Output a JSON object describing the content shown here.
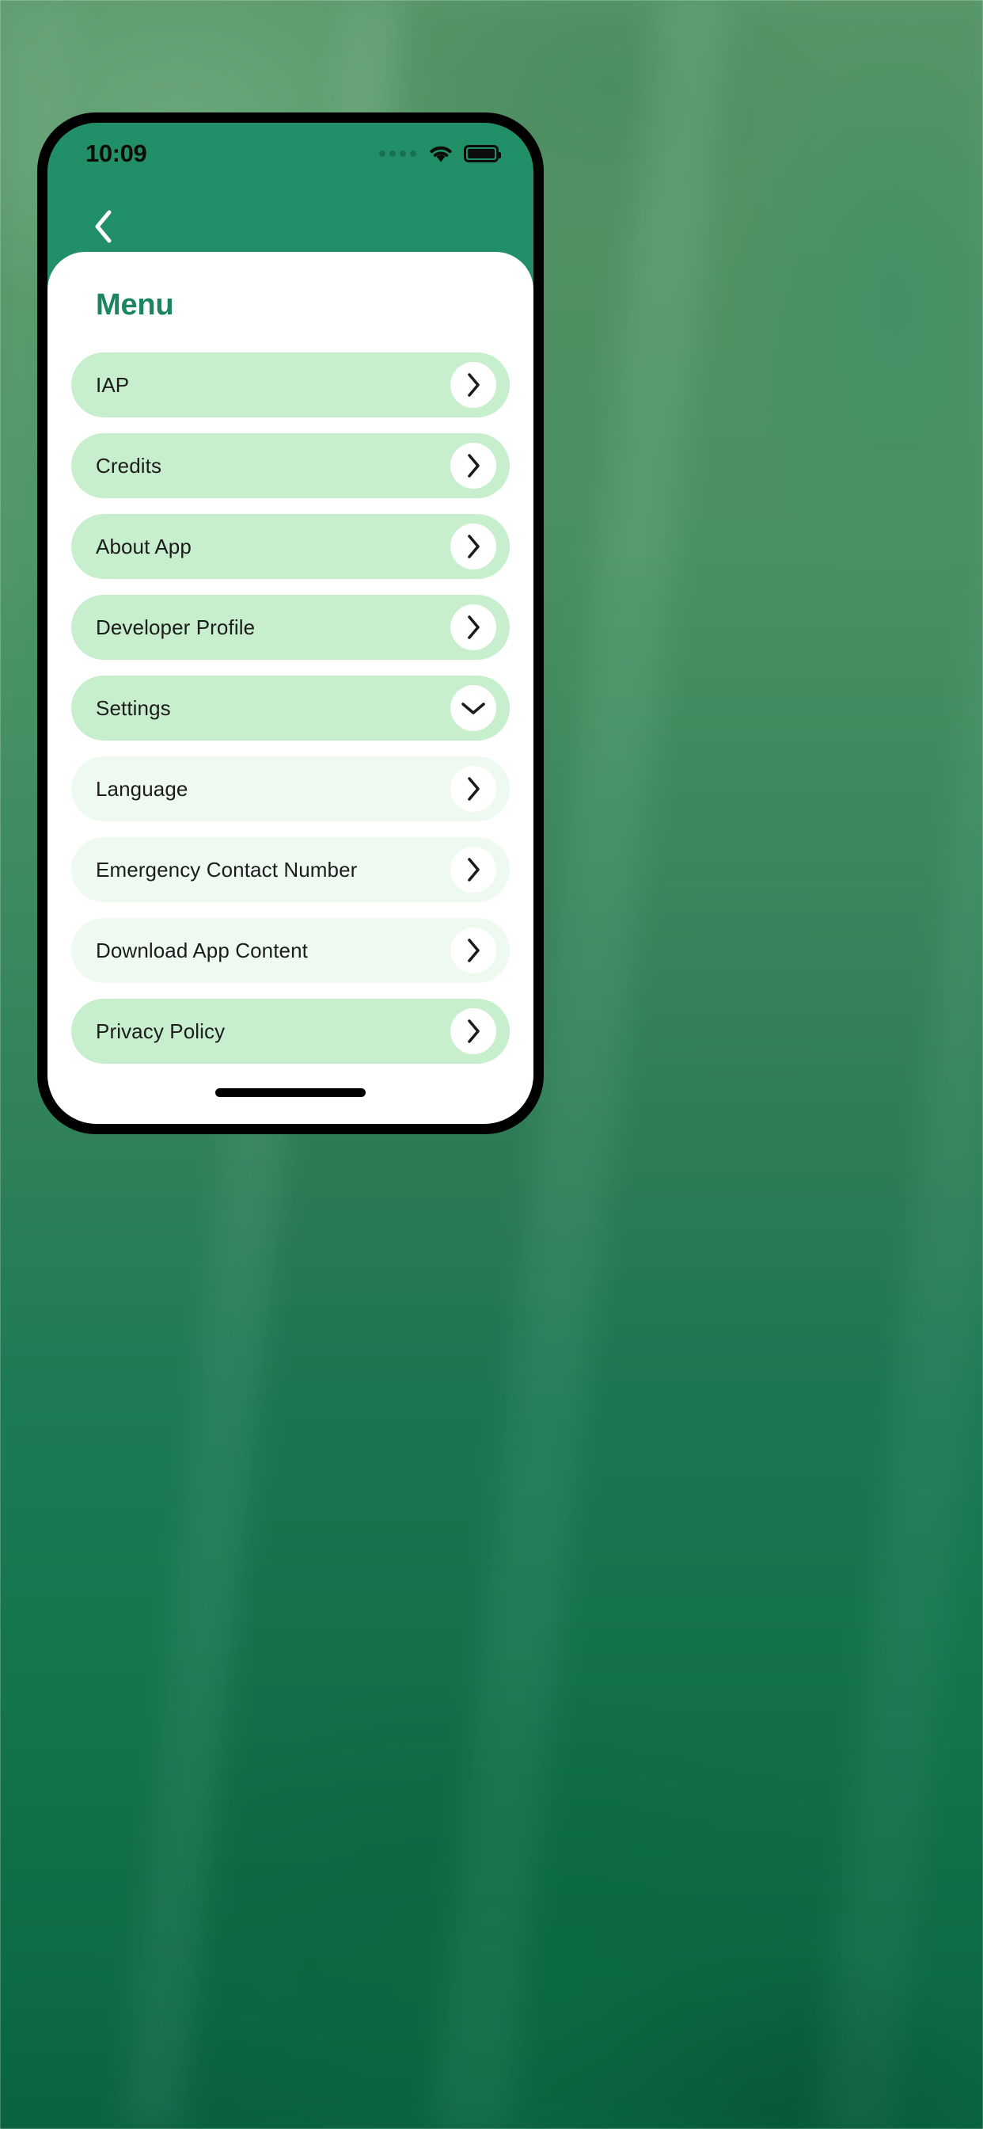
{
  "status_bar": {
    "time": "10:09",
    "signal_icon": "signal-dots-icon",
    "wifi_icon": "wifi-icon",
    "battery_icon": "battery-full-icon"
  },
  "nav": {
    "back_icon": "chevron-left-icon"
  },
  "screen": {
    "title": "Menu"
  },
  "colors": {
    "header_green": "#219068",
    "title_green": "#1a8560",
    "pill_main": "#c7eecd",
    "pill_sub": "#eefaef",
    "action_circle": "#ffffff",
    "label_text": "#1c1c1c"
  },
  "menu": {
    "items": [
      {
        "label": "IAP",
        "level": "main",
        "action_icon": "chevron-right-icon"
      },
      {
        "label": "Credits",
        "level": "main",
        "action_icon": "chevron-right-icon"
      },
      {
        "label": "About App",
        "level": "main",
        "action_icon": "chevron-right-icon"
      },
      {
        "label": "Developer Profile",
        "level": "main",
        "action_icon": "chevron-right-icon"
      },
      {
        "label": "Settings",
        "level": "main",
        "action_icon": "chevron-down-icon"
      },
      {
        "label": "Language",
        "level": "sub",
        "action_icon": "chevron-right-icon"
      },
      {
        "label": "Emergency Contact Number",
        "level": "sub",
        "action_icon": "chevron-right-icon"
      },
      {
        "label": "Download App Content",
        "level": "sub",
        "action_icon": "chevron-right-icon"
      },
      {
        "label": "Privacy Policy",
        "level": "main",
        "action_icon": "chevron-right-icon"
      }
    ]
  },
  "system": {
    "home_indicator": "home-indicator"
  }
}
